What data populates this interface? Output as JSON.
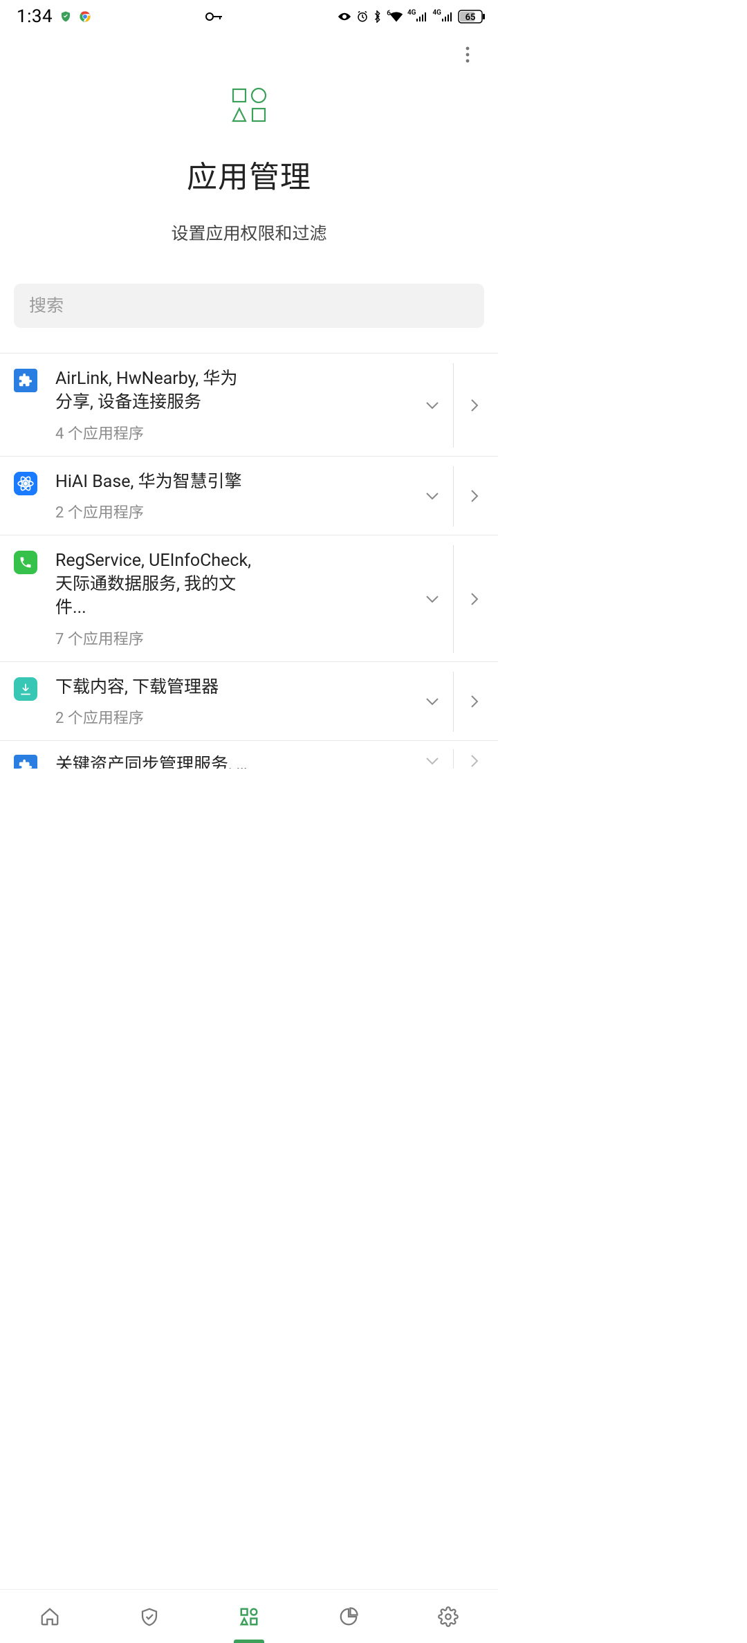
{
  "status": {
    "time": "1:34",
    "battery_text": "65"
  },
  "header": {
    "title": "应用管理",
    "subtitle": "设置应用权限和过滤"
  },
  "search": {
    "placeholder": "搜索"
  },
  "groups": [
    {
      "icon": "puzzle-blue",
      "title": "AirLink, HwNearby, 华为分享, 设备连接服务",
      "sub": "4 个应用程序"
    },
    {
      "icon": "atom-blue",
      "title": "HiAI Base, 华为智慧引擎",
      "sub": "2 个应用程序"
    },
    {
      "icon": "phone-green",
      "title": "RegService, UEInfoCheck, 天际通数据服务, 我的文件...",
      "sub": "7 个应用程序"
    },
    {
      "icon": "download-teal",
      "title": "下载内容, 下载管理器",
      "sub": "2 个应用程序"
    },
    {
      "icon": "puzzle-blue-partial",
      "title": "关键资产同步管理服务, 安",
      "sub": ""
    }
  ]
}
